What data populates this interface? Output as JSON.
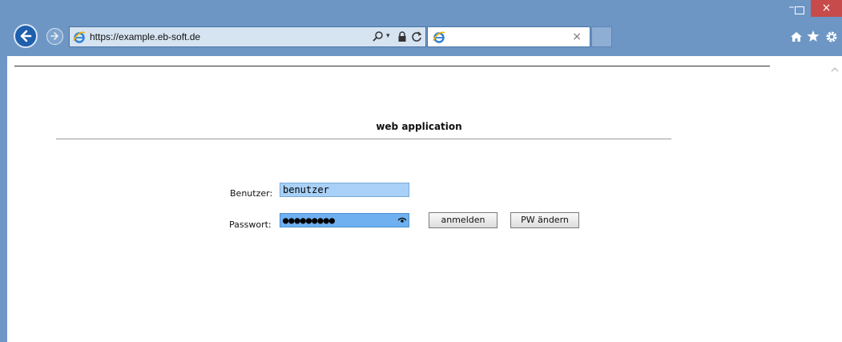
{
  "browser": {
    "url": "https://example.eb-soft.de",
    "tab_title": "",
    "tab_close": "×",
    "window_close": "×",
    "window_minimize": "–",
    "icons": {
      "back": "back-arrow-icon",
      "forward": "forward-arrow-icon",
      "site": "internet-explorer-icon",
      "search": "search-icon",
      "lock": "lock-icon",
      "refresh": "refresh-icon",
      "home": "home-icon",
      "favorites": "star-icon",
      "tools": "gear-icon"
    },
    "colors": {
      "frame": "#6d96c5",
      "close": "#c74b4b"
    }
  },
  "page": {
    "title": "web application"
  },
  "form": {
    "username_label": "Benutzer:",
    "username_value": "benutzer",
    "password_label": "Passwort:",
    "password_value": "●●●●●●●●●",
    "login_button": "anmelden",
    "change_pw_button": "PW ändern"
  }
}
